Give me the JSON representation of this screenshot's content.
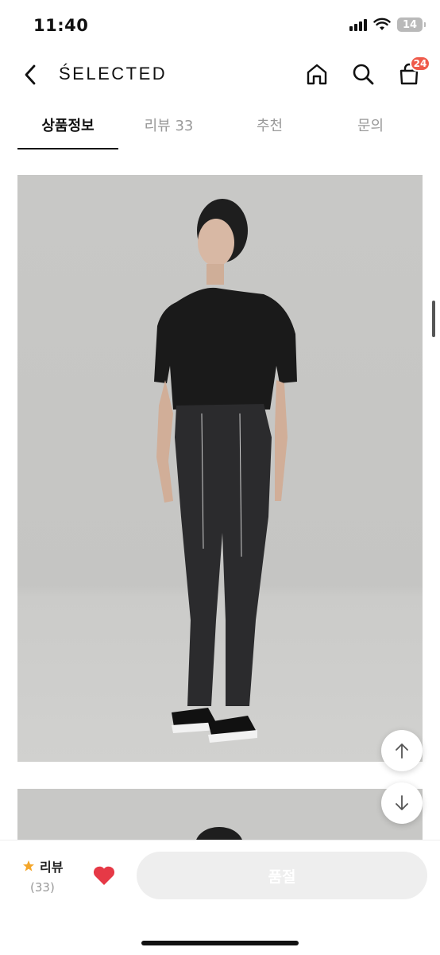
{
  "status_bar": {
    "time": "11:40",
    "battery": "14"
  },
  "header": {
    "brand": "ŚELECTED",
    "cart_count": "24"
  },
  "tabs": [
    {
      "label": "상품정보",
      "active": true
    },
    {
      "label": "리뷰 33",
      "active": false
    },
    {
      "label": "추천",
      "active": false
    },
    {
      "label": "문의",
      "active": false
    }
  ],
  "product_images": [
    {
      "description_icon": "model-photo-full-body"
    },
    {
      "description_icon": "model-photo-partial"
    }
  ],
  "bottom_bar": {
    "review_label": "리뷰",
    "review_count": "(33)",
    "soldout_label": "품절",
    "liked": true
  },
  "colors": {
    "accent_red": "#ef5a4a",
    "heart": "#e63946",
    "star": "#f4a62a",
    "disabled": "#eeeeee"
  }
}
